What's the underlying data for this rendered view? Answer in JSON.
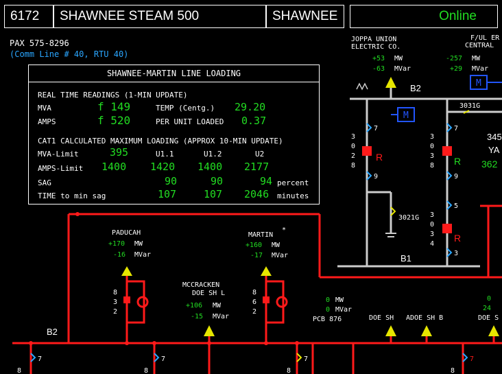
{
  "header": {
    "station_id": "6172",
    "station_name": "SHAWNEE STEAM 500",
    "area": "SHAWNEE",
    "status": "Online",
    "status_color": "#22dd22"
  },
  "info": {
    "pax": "PAX  575-8296",
    "comm": "(Comm Line # 40, RTU 40)"
  },
  "panel": {
    "title": "SHAWNEE-MARTIN LINE LOADING",
    "rt_heading": "REAL TIME READINGS (1-MIN UPDATE)",
    "mva_label": "MVA",
    "mva_value": "f 149",
    "amps_label": "AMPS",
    "amps_value": "f 520",
    "temp_label": "TEMP (Centg.)",
    "temp_value": "29.20",
    "pu_label": "PER UNIT LOADED",
    "pu_value": "0.37",
    "calc_heading": "CAT1 CALCULATED MAXIMUM LOADING (APPROX 10-MIN UPDATE)",
    "col_u11": "U1.1",
    "col_u12": "U1.2",
    "col_u2": "U2",
    "mva_limit_label": "MVA-Limit",
    "mva_limit": "395",
    "amps_limit_label": "AMPS-Limit",
    "amps_limit": [
      "1400",
      "1420",
      "1400",
      "2177"
    ],
    "sag_label": "SAG",
    "sag": [
      "90",
      "90",
      "94"
    ],
    "sag_unit": "percent",
    "time_label": "TIME to min sag",
    "time": [
      "107",
      "107",
      "2046"
    ],
    "time_unit": "minutes"
  },
  "diagram": {
    "joppa": {
      "name1": "JOPPA UNION",
      "name2": "ELECTRIC CO.",
      "mw": "+53",
      "mvar": "-63"
    },
    "fulfer": {
      "name1": "F/UL ER",
      "name2": "CENTRAL",
      "mw": "-257",
      "mvar": "+29"
    },
    "units_mw": "MW",
    "units_mvar": "MVar",
    "bus_b2_top": "B2",
    "bus_b1": "B1",
    "bus_b2_bottom": "B2",
    "breaker_3031g_top": "3031G",
    "breaker_3021g": "3021G",
    "label_345": "345",
    "label_ya": "YA",
    "value_362": "362",
    "m_symbol": "M",
    "r_symbol": "R",
    "paducah": {
      "name": "PADUCAH",
      "mw": "+170",
      "mvar": "-16"
    },
    "martin": {
      "name": "MARTIN",
      "star": "*",
      "mw": "+160",
      "mvar": "-17"
    },
    "mccracken": {
      "name1": "MCCRACKEN",
      "name2": "DOE SH L",
      "mw": "+106",
      "mvar": "-15"
    },
    "pcb876": {
      "mw": "0",
      "mvar": "0",
      "name": "PCB 876"
    },
    "doe_sh": "DOE SH",
    "adoe_sh_b": "ADOE SH B",
    "doe_s": "DOE S",
    "right_edge": {
      "mw": "0",
      "mvar": "24"
    },
    "switch_labels": [
      "7",
      "9",
      "5",
      "3"
    ],
    "position_digits_left": [
      "3",
      "0",
      "2",
      "8"
    ],
    "position_digits_mid": [
      "3",
      "0",
      "3",
      "8"
    ],
    "position_digits_mid2": [
      "3",
      "0",
      "3",
      "4"
    ],
    "position_digits_pad": [
      "8",
      "3",
      "2"
    ],
    "position_digits_mar": [
      "8",
      "6",
      "2"
    ],
    "bottom_digit": "8"
  }
}
